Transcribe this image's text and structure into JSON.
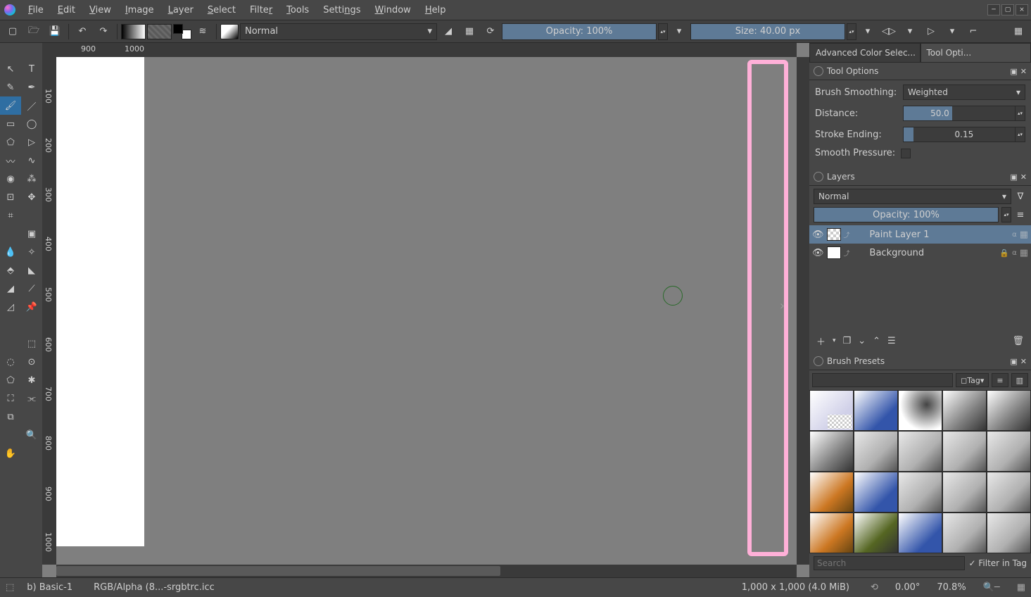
{
  "menu": {
    "items": [
      "File",
      "Edit",
      "View",
      "Image",
      "Layer",
      "Select",
      "Filter",
      "Tools",
      "Settings",
      "Window",
      "Help"
    ]
  },
  "toolbar": {
    "blend_mode": "Normal",
    "opacity_label": "Opacity: 100%",
    "size_label": "Size: 40.00 px"
  },
  "dock_tabs": {
    "left": "Advanced Color Selec...",
    "right": "Tool Opti..."
  },
  "tool_options": {
    "title": "Tool Options",
    "smoothing_label": "Brush Smoothing:",
    "smoothing_value": "Weighted",
    "distance_label": "Distance:",
    "distance_value": "50.0",
    "stroke_ending_label": "Stroke Ending:",
    "stroke_ending_value": "0.15",
    "smooth_pressure_label": "Smooth Pressure:"
  },
  "layers": {
    "title": "Layers",
    "blend_mode": "Normal",
    "opacity_label": "Opacity:  100%",
    "items": [
      {
        "name": "Paint Layer 1",
        "selected": true,
        "checker": true,
        "locked": false
      },
      {
        "name": "Background",
        "selected": false,
        "checker": false,
        "locked": true
      }
    ]
  },
  "brush_presets": {
    "title": "Brush Presets",
    "tag_label": "Tag",
    "search_placeholder": "Search",
    "filter_label": "Filter in Tag"
  },
  "ruler": {
    "h": [
      "900",
      "1000"
    ],
    "v": [
      "100",
      "200",
      "300",
      "400",
      "500",
      "600",
      "700",
      "800",
      "900",
      "1000"
    ]
  },
  "status": {
    "brush": "b) Basic-1",
    "color": "RGB/Alpha (8...-srgbtrc.icc",
    "dims": "1,000 x 1,000 (4.0 MiB)",
    "angle": "0.00°",
    "zoom": "70.8%"
  }
}
